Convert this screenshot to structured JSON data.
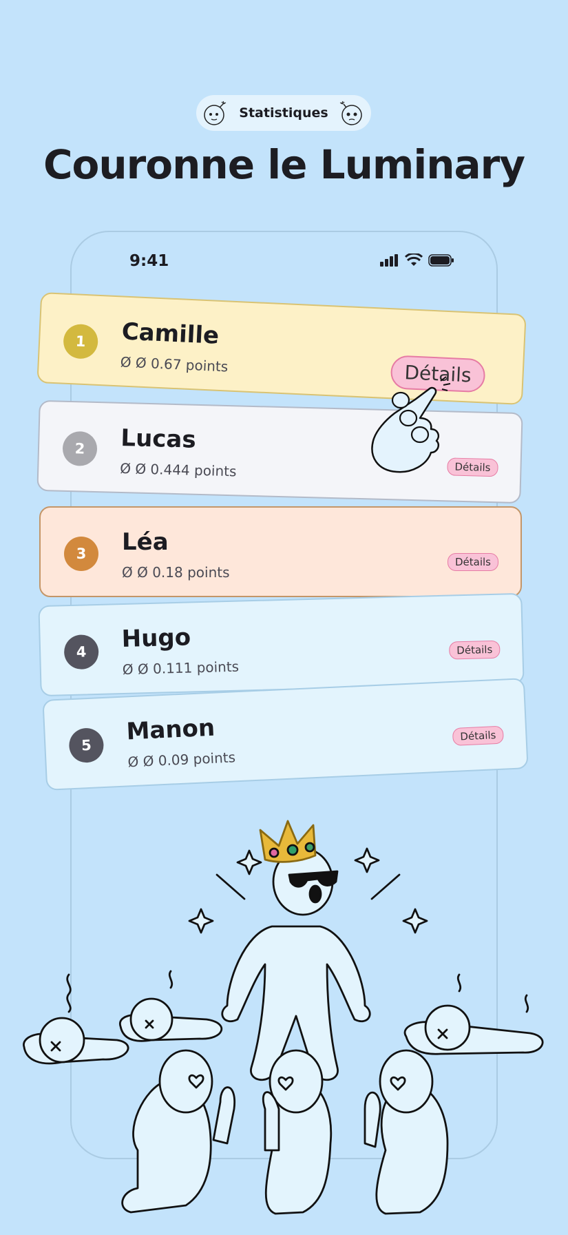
{
  "header": {
    "badge_label": "Statistiques",
    "title": "Couronne le Luminary"
  },
  "status_bar": {
    "time": "9:41"
  },
  "leaderboard": [
    {
      "rank": "1",
      "name": "Camille",
      "points": "Ø Ø 0.67 points",
      "details": "Détails",
      "color": "#d3b93f",
      "card_color": "#fdf1c7"
    },
    {
      "rank": "2",
      "name": "Lucas",
      "points": "Ø Ø 0.444 points",
      "details": "Détails",
      "color": "#a9a9ae",
      "card_color": "#f4f5f9"
    },
    {
      "rank": "3",
      "name": "Léa",
      "points": "Ø Ø 0.18 points",
      "details": "Détails",
      "color": "#d2893d",
      "card_color": "#fee7da"
    },
    {
      "rank": "4",
      "name": "Hugo",
      "points": "Ø Ø 0.111 points",
      "details": "Détails",
      "color": "#54545f",
      "card_color": "#e3f4fd"
    },
    {
      "rank": "5",
      "name": "Manon",
      "points": "Ø Ø 0.09 points",
      "details": "Détails",
      "color": "#54545f",
      "card_color": "#e3f4fd"
    }
  ],
  "icons": {
    "badge_left": "bomb-face-icon",
    "badge_right": "bomb-face-icon",
    "signal": "cellular-signal-icon",
    "wifi": "wifi-icon",
    "battery": "battery-icon",
    "pointer": "pointing-hand-icon"
  },
  "colors": {
    "background": "#c3e3fb",
    "accent_pink": "#f9c2d7"
  }
}
